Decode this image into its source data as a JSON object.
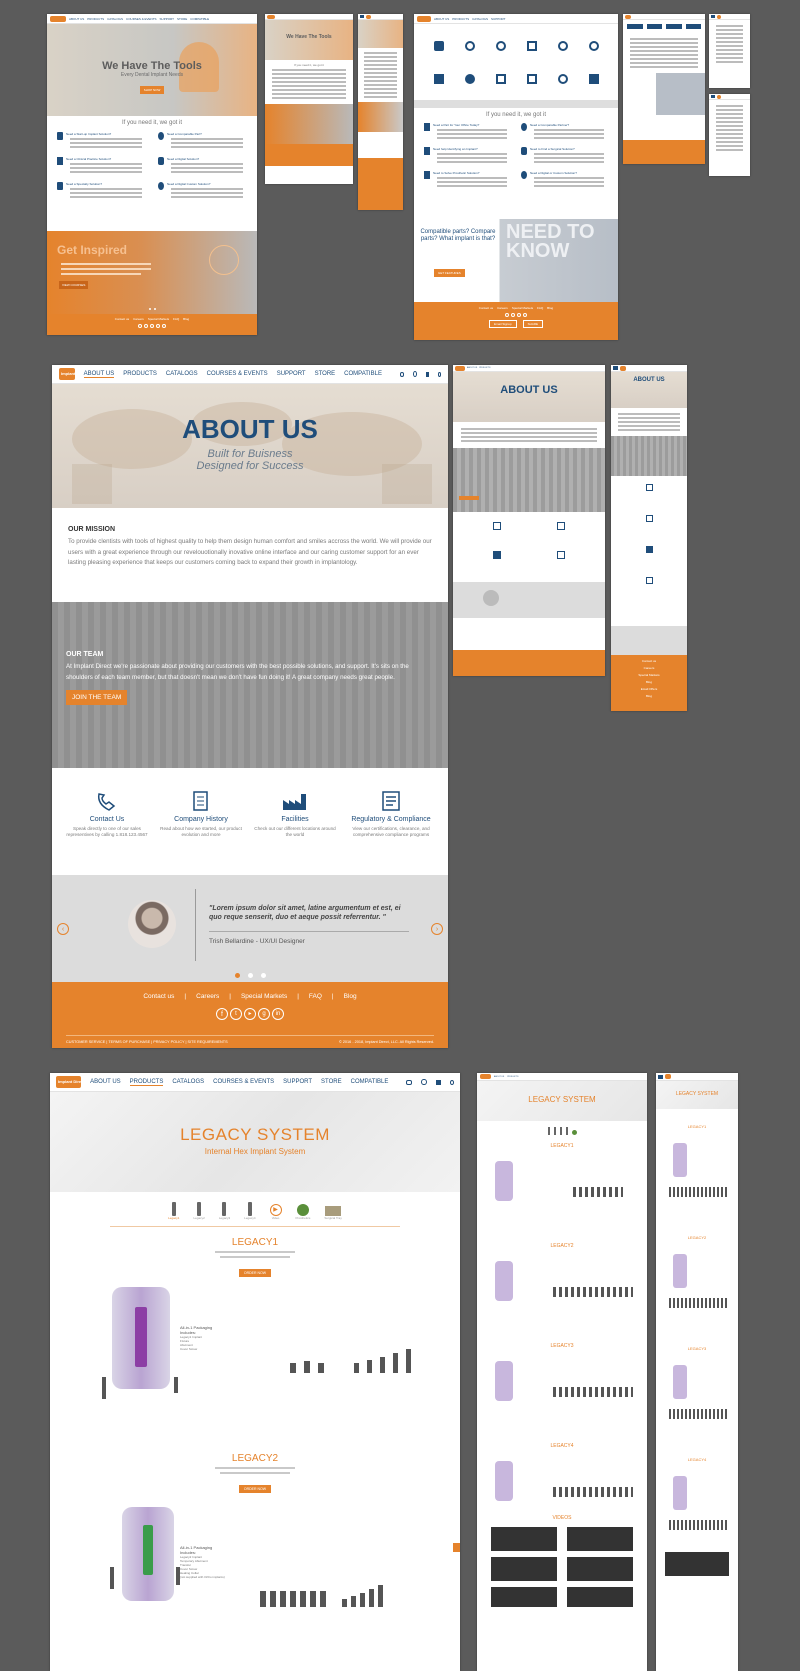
{
  "colors": {
    "accent": "#e5832c",
    "navy": "#1f4d7a",
    "canvas": "#5b5b5b"
  },
  "home": {
    "nav": [
      "ABOUT US",
      "PRODUCTS",
      "CATALOGS",
      "COURSES & EVENTS",
      "SUPPORT",
      "STORE",
      "COMPATIBLE"
    ],
    "hero_title": "We Have The Tools",
    "hero_sub": "Every Dental Implant Needs",
    "hero_btn": "SHOP NOW",
    "need_heading": "If you need it, we got it",
    "need_items": [
      "Need a Start-up Implant Solution?",
      "Need a Comparable Part?",
      "Need a Clinical Practice Solution?",
      "Need a Digital Solution?",
      "Need a Specialty Solution?",
      "Need a Digital Custom Solution?"
    ],
    "inspired_title": "Get Inspired",
    "inspired_btn": "VIEW COURSES",
    "footer_links": [
      "Contact us",
      "Careers",
      "Special Markets",
      "FAQ",
      "Blog"
    ]
  },
  "support": {
    "need_heading": "If you need it, we got it",
    "items": [
      "Need a Part for Your Office Today?",
      "Need a Comparable Partner?",
      "Need help Identifying an Implant?",
      "Need to Find a Surgical Solution?",
      "Need to Solve Prosthetic Solution?",
      "Need a Digital or Custom Solution?"
    ],
    "compat_title": "Compatible parts? Compare parts? What implant is that?",
    "ntk_title": "NEED TO KNOW",
    "ntk_btn": "GET FEATURES",
    "footer_links": [
      "Contact us",
      "Careers",
      "Special Markets",
      "FAQ",
      "Blog"
    ],
    "footer_btns": [
      "Email Signup",
      "SHARE"
    ]
  },
  "about": {
    "nav": [
      "ABOUT US",
      "PRODUCTS",
      "CATALOGS",
      "COURSES & EVENTS",
      "SUPPORT",
      "STORE",
      "COMPATIBLE"
    ],
    "logo": "Implant Direct",
    "hero_title": "ABOUT US",
    "hero_sub1": "Built for Buisness",
    "hero_sub2": "Designed for Success",
    "mission_heading": "OUR MISSION",
    "mission_text": "To provide clentists with tools of highest quality to help them design human comfort and smiles accross the world. We will provide our users with a great experience through our revelouotionally inovative online interface and our caring customer support for an ever lasting pleasing experience that keeps our customers coming back to expand their growth in implantology.",
    "team_heading": "OUR TEAM",
    "team_text": "At Implant Direct we're passionate about providing our customers with the best possible solutions, and support. It's sits on the shoulders of each team member, but that doesn't mean we don't have fun doing it! A great company needs great people.",
    "team_btn": "JOIN THE TEAM",
    "features": [
      {
        "icon": "phone-icon",
        "title": "Contact Us",
        "text": "Speak directly to one of our sales representives by calling 1.818.123.4567"
      },
      {
        "icon": "scroll-icon",
        "title": "Company History",
        "text": "Read about how we started, our product evolution and more"
      },
      {
        "icon": "factory-icon",
        "title": "Facilities",
        "text": "Check out our different locations around the world"
      },
      {
        "icon": "checklist-icon",
        "title": "Regulatory & Compliance",
        "text": "View our certifications, clearance, and comprehensive compliance programs"
      }
    ],
    "quote": "\"Lorem ipsum dolor sit amet, latine argumentum et est, ei quo reque senserit, duo et aeque possit referrentur. \"",
    "quote_author": "Trish Bellardine - UX/UI Designer",
    "footer_links": [
      "Contact us",
      "Careers",
      "Special Markets",
      "FAQ",
      "Blog"
    ],
    "legal": "CUSTOMER SERVICE | TERMS OF PURCHASE | PRIVACY POLICY | SITE REQUIREMENTS",
    "copyright": "© 2016 - 2018, Implant Direct, LLC. All Rights Reserved.",
    "tablet_title": "ABOUT US",
    "mobile_title": "ABOUT US",
    "mobile_links": [
      "Contact us",
      "Careers",
      "Special Markets",
      "Blog",
      "Email Offers",
      "Blog"
    ]
  },
  "legacy": {
    "nav": [
      "ABOUT US",
      "PRODUCTS",
      "CATALOGS",
      "COURSES & EVENTS",
      "SUPPORT",
      "STORE",
      "COMPATIBLE"
    ],
    "logo": "Implant Direct",
    "title": "LEGACY SYSTEM",
    "subtitle": "Internal Hex Implant System",
    "thumbs": [
      "Legacy1",
      "Legacy2",
      "Legacy3",
      "Legacy4",
      "Video",
      "Prosthetics",
      "Surgical Tray"
    ],
    "sections": [
      {
        "title": "LEGACY1",
        "btn": "ORDER NOW",
        "pack_title": "All-in-1 Packaging Includes:",
        "pack_items": [
          "Legacy1 Implant",
          "Fixture",
          "Abutment",
          "Cover Screw"
        ]
      },
      {
        "title": "LEGACY2",
        "btn": "ORDER NOW",
        "pack_title": "All-in-1 Packaging Includes:",
        "pack_items": [
          "Legacy2 Implant",
          "Temporary Abutment",
          "Transfer",
          "Cover Screw",
          "Healing Collar",
          "(not supplied with Ortho implants)"
        ]
      }
    ],
    "tablet_title": "LEGACY SYSTEM",
    "tablet_sections": [
      "LEGACY1",
      "LEGACY2",
      "LEGACY3",
      "LEGACY4",
      "VIDEOS"
    ],
    "mobile_title": "LEGACY SYSTEM",
    "mobile_sections": [
      "LEGACY1",
      "LEGACY2",
      "LEGACY3",
      "LEGACY4"
    ]
  }
}
